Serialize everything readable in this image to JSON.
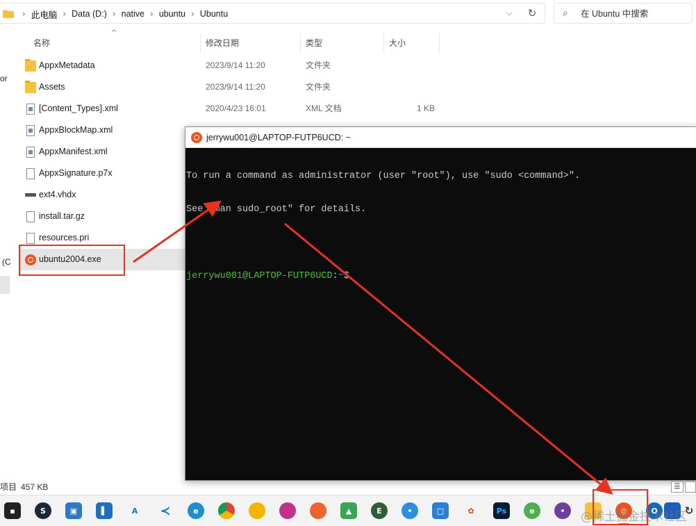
{
  "address_bar": {
    "breadcrumbs": [
      "此电脑",
      "Data (D:)",
      "native",
      "ubuntu",
      "Ubuntu"
    ],
    "dropdown_glyph": "⌵",
    "refresh_glyph": "↻"
  },
  "search": {
    "icon": "search-icon",
    "placeholder": "在 Ubuntu 中搜索"
  },
  "nav_fragments": {
    "frag1": "or",
    "frag2": "(C"
  },
  "columns": {
    "name": "名称",
    "modified": "修改日期",
    "type": "类型",
    "size": "大小"
  },
  "files": [
    {
      "name": "AppxMetadata",
      "modified": "2023/9/14 11:20",
      "type": "文件夹",
      "size": "",
      "icon": "folder-icon"
    },
    {
      "name": "Assets",
      "modified": "2023/9/14 11:20",
      "type": "文件夹",
      "size": "",
      "icon": "folder-icon"
    },
    {
      "name": "[Content_Types].xml",
      "modified": "2020/4/23 16:01",
      "type": "XML 文档",
      "size": "1 KB",
      "icon": "xml-file-icon"
    },
    {
      "name": "AppxBlockMap.xml",
      "modified": "",
      "type": "",
      "size": "",
      "icon": "xml-file-icon"
    },
    {
      "name": "AppxManifest.xml",
      "modified": "",
      "type": "",
      "size": "",
      "icon": "xml-file-icon"
    },
    {
      "name": "AppxSignature.p7x",
      "modified": "",
      "type": "",
      "size": "",
      "icon": "file-icon"
    },
    {
      "name": "ext4.vhdx",
      "modified": "",
      "type": "",
      "size": "",
      "icon": "disk-image-icon"
    },
    {
      "name": "install.tar.gz",
      "modified": "",
      "type": "",
      "size": "",
      "icon": "file-icon"
    },
    {
      "name": "resources.pri",
      "modified": "",
      "type": "",
      "size": "",
      "icon": "file-icon"
    },
    {
      "name": "ubuntu2004.exe",
      "modified": "",
      "type": "",
      "size": "",
      "icon": "ubuntu-icon",
      "selected": true
    }
  ],
  "status": {
    "items_label": "项目",
    "size": "457 KB"
  },
  "terminal": {
    "title": "jerrywu001@LAPTOP-FUTP6UCD: ~",
    "line1": "To run a command as administrator (user \"root\"), use \"sudo <command>\".",
    "line2": "See \"man sudo_root\" for details.",
    "prompt_user": "jerrywu001@LAPTOP-FUTP6UCD",
    "prompt_colon": ":",
    "prompt_path": "~",
    "prompt_symbol": "$"
  },
  "taskbar": {
    "icons": [
      "start-icon",
      "steam-icon",
      "remote-desktop-icon",
      "sticky-app-icon",
      "arc-icon",
      "vscode-icon",
      "edge-icon",
      "chrome-icon",
      "chrome-canary-icon",
      "firefox-dev-icon",
      "firefox-icon",
      "sourcetree-icon",
      "evernote-icon",
      "lightbulb-app-icon",
      "app-icon",
      "share-icon",
      "photoshop-icon",
      "edge-dev-icon",
      "purple-app-icon",
      "file-explorer-icon",
      "ubuntu-icon",
      "outlook-icon",
      "blue-app-icon",
      "refresh-tray-icon"
    ],
    "accent": "#5a8be6"
  },
  "watermark": "@稀土掘金技术社区",
  "colors": {
    "annotation_red": "#e8311f",
    "ubuntu_orange": "#e95420",
    "terminal_bg": "#0c0c0c",
    "prompt_green": "#4dbd3a",
    "prompt_blue": "#3b78ff"
  }
}
